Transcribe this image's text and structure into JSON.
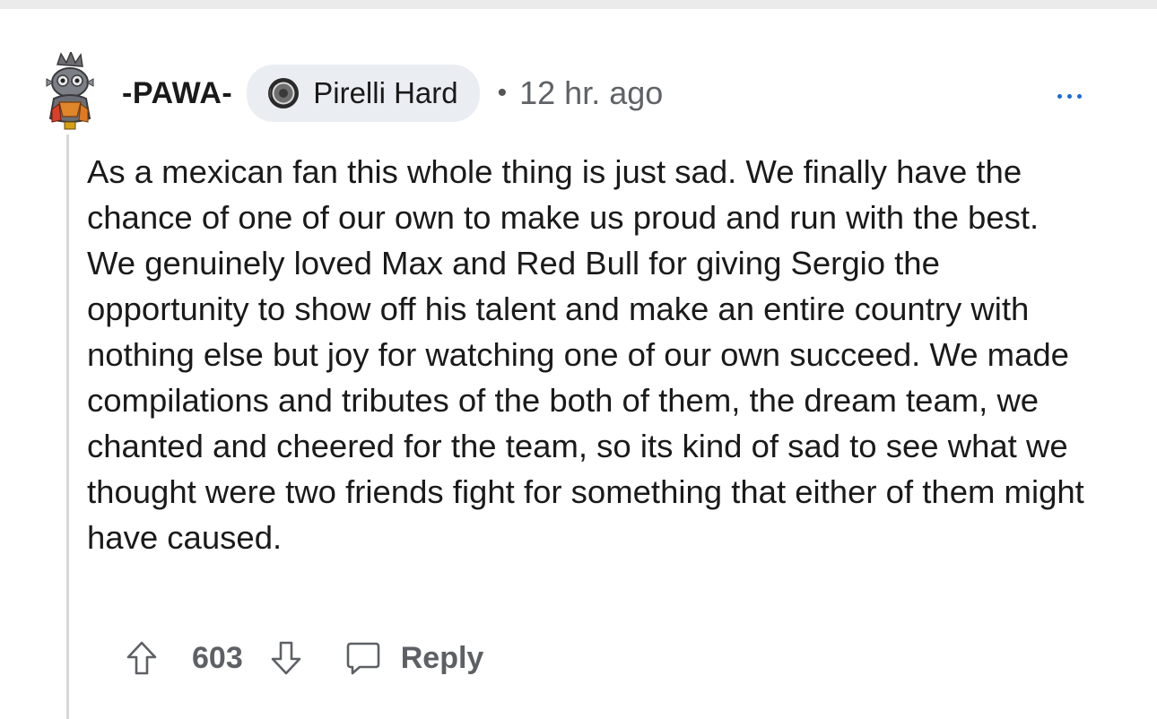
{
  "comment": {
    "username": "-PAWA-",
    "flair": {
      "text": "Pirelli Hard",
      "icon": "tire-icon"
    },
    "separator": "•",
    "timestamp": "12 hr. ago",
    "more_icon": "ellipsis-icon",
    "body": "As a mexican fan this whole thing is just sad. We finally have the chance of one of our own to make us proud and run with the best. We genuinely loved Max and Red Bull for giving Sergio the opportunity to show off his talent and make an entire country with nothing else but joy for watching one of our own succeed. We made compilations and tributes of the both of them, the dream team, we chanted and cheered for the team, so its kind of sad to see what we thought were two friends fight for something that either of them might have caused.",
    "actions": {
      "upvote_icon": "upvote-arrow-icon",
      "score": "603",
      "downvote_icon": "downvote-arrow-icon",
      "reply_icon": "speech-bubble-icon",
      "reply_label": "Reply"
    }
  },
  "colors": {
    "text": "#1a1a1b",
    "meta": "#5f6266",
    "flair_bg": "#eaedf2",
    "more_dots": "#1a6ad6",
    "thread_line": "#d7d7d7"
  }
}
